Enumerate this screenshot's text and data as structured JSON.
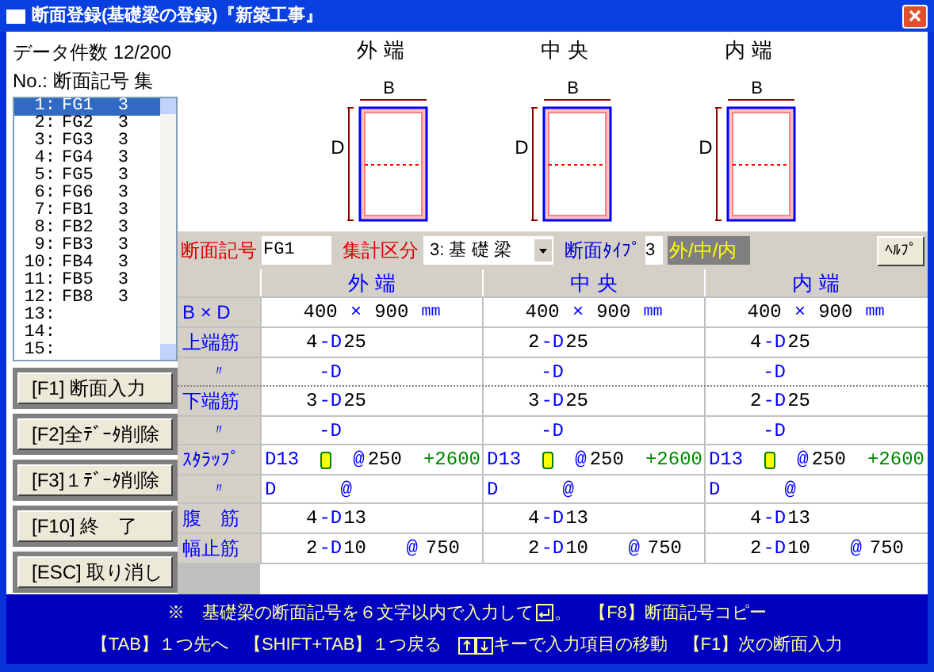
{
  "window": {
    "title": "断面登録(基礎梁の登録)『新築工事』"
  },
  "data_count": "データ件数 12/200",
  "list_header": "No.: 断面記号 集",
  "list": [
    {
      "no": "1:",
      "symbol": "FG1",
      "count": "3",
      "selected": true
    },
    {
      "no": "2:",
      "symbol": "FG2",
      "count": "3",
      "selected": false
    },
    {
      "no": "3:",
      "symbol": "FG3",
      "count": "3",
      "selected": false
    },
    {
      "no": "4:",
      "symbol": "FG4",
      "count": "3",
      "selected": false
    },
    {
      "no": "5:",
      "symbol": "FG5",
      "count": "3",
      "selected": false
    },
    {
      "no": "6:",
      "symbol": "FG6",
      "count": "3",
      "selected": false
    },
    {
      "no": "7:",
      "symbol": "FB1",
      "count": "3",
      "selected": false
    },
    {
      "no": "8:",
      "symbol": "FB2",
      "count": "3",
      "selected": false
    },
    {
      "no": "9:",
      "symbol": "FB3",
      "count": "3",
      "selected": false
    },
    {
      "no": "10:",
      "symbol": "FB4",
      "count": "3",
      "selected": false
    },
    {
      "no": "11:",
      "symbol": "FB5",
      "count": "3",
      "selected": false
    },
    {
      "no": "12:",
      "symbol": "FB8",
      "count": "3",
      "selected": false
    },
    {
      "no": "13:",
      "selected": false
    },
    {
      "no": "14:",
      "selected": false
    },
    {
      "no": "15:",
      "selected": false
    }
  ],
  "buttons": [
    "[F1] 断面入力",
    "[F2]全ﾃﾞｰﾀ削除",
    "[F3]１ﾃﾞｰﾀ削除",
    "[F10] 終　了",
    "[ESC] 取り消し"
  ],
  "diagrams": [
    {
      "title": "外 端",
      "b": "B",
      "d": "D"
    },
    {
      "title": "中 央",
      "b": "B",
      "d": "D"
    },
    {
      "title": "内 端",
      "b": "B",
      "d": "D"
    }
  ],
  "toolbar": {
    "symbol_label": "断面記号",
    "symbol_value": "FG1",
    "category_label": "集計区分",
    "category_value": "3: 基 礎 梁",
    "type_label": "断面ﾀｲﾌﾟ",
    "type_value": "3",
    "type_display": "外/中/内",
    "help": "ﾍﾙﾌﾟ"
  },
  "table": {
    "columns": [
      "外 端",
      "中 央",
      "内 端"
    ],
    "rows": [
      {
        "label": "B × D",
        "kind": "size",
        "cells": [
          [
            {
              "kind": "num",
              "text": "400"
            },
            {
              "kind": "sym",
              "text": "×"
            },
            {
              "kind": "num",
              "text": "900"
            },
            {
              "kind": "unit",
              "text": "mm"
            }
          ],
          [
            {
              "kind": "num",
              "text": "400"
            },
            {
              "kind": "sym",
              "text": "×"
            },
            {
              "kind": "num",
              "text": "900"
            },
            {
              "kind": "unit",
              "text": "mm"
            }
          ],
          [
            {
              "kind": "num",
              "text": "400"
            },
            {
              "kind": "sym",
              "text": "×"
            },
            {
              "kind": "num",
              "text": "900"
            },
            {
              "kind": "unit",
              "text": "mm"
            }
          ]
        ]
      },
      {
        "label": "上端筋",
        "kind": "bar",
        "cells": [
          [
            {
              "kind": "num",
              "text": "4"
            },
            {
              "kind": "sym",
              "text": "-D"
            },
            {
              "kind": "num",
              "text": "25"
            }
          ],
          [
            {
              "kind": "num",
              "text": "2"
            },
            {
              "kind": "sym",
              "text": "-D"
            },
            {
              "kind": "num",
              "text": "25"
            }
          ],
          [
            {
              "kind": "num",
              "text": "4"
            },
            {
              "kind": "sym",
              "text": "-D"
            },
            {
              "kind": "num",
              "text": "25"
            }
          ]
        ]
      },
      {
        "label": "〃",
        "kind": "bar_sub",
        "cells": [
          [
            {
              "kind": "sym",
              "text": "-D"
            }
          ],
          [
            {
              "kind": "sym",
              "text": "-D"
            }
          ],
          [
            {
              "kind": "sym",
              "text": "-D"
            }
          ]
        ]
      },
      {
        "label": "下端筋",
        "kind": "bar",
        "cells": [
          [
            {
              "kind": "num",
              "text": "3"
            },
            {
              "kind": "sym",
              "text": "-D"
            },
            {
              "kind": "num",
              "text": "25"
            }
          ],
          [
            {
              "kind": "num",
              "text": "3"
            },
            {
              "kind": "sym",
              "text": "-D"
            },
            {
              "kind": "num",
              "text": "25"
            }
          ],
          [
            {
              "kind": "num",
              "text": "2"
            },
            {
              "kind": "sym",
              "text": "-D"
            },
            {
              "kind": "num",
              "text": "25"
            }
          ]
        ]
      },
      {
        "label": "〃",
        "kind": "bar_sub",
        "cells": [
          [
            {
              "kind": "sym",
              "text": "-D"
            }
          ],
          [
            {
              "kind": "sym",
              "text": "-D"
            }
          ],
          [
            {
              "kind": "sym",
              "text": "-D"
            }
          ]
        ]
      },
      {
        "label": "ｽﾀﾗｯﾌﾟ",
        "kind": "stirrup",
        "cells": [
          [
            {
              "kind": "sym",
              "text": "D13"
            },
            {
              "kind": "marker"
            },
            {
              "kind": "at",
              "text": "@"
            },
            {
              "kind": "num",
              "text": "250"
            },
            {
              "kind": "extra",
              "text": "+2600"
            }
          ],
          [
            {
              "kind": "sym",
              "text": "D13"
            },
            {
              "kind": "marker"
            },
            {
              "kind": "at",
              "text": "@"
            },
            {
              "kind": "num",
              "text": "250"
            },
            {
              "kind": "extra",
              "text": "+2600"
            }
          ],
          [
            {
              "kind": "sym",
              "text": "D13"
            },
            {
              "kind": "marker"
            },
            {
              "kind": "at",
              "text": "@"
            },
            {
              "kind": "num",
              "text": "250"
            },
            {
              "kind": "extra",
              "text": "+2600"
            }
          ]
        ]
      },
      {
        "label": "〃",
        "kind": "stirrup_sub",
        "cells": [
          [
            {
              "kind": "sym",
              "text": "D"
            },
            {
              "kind": "at",
              "text": "@"
            }
          ],
          [
            {
              "kind": "sym",
              "text": "D"
            },
            {
              "kind": "at",
              "text": "@"
            }
          ],
          [
            {
              "kind": "sym",
              "text": "D"
            },
            {
              "kind": "at",
              "text": "@"
            }
          ]
        ]
      },
      {
        "label": "腹　筋",
        "kind": "bar",
        "cells": [
          [
            {
              "kind": "num",
              "text": "4"
            },
            {
              "kind": "sym",
              "text": "-D"
            },
            {
              "kind": "num",
              "text": "13"
            }
          ],
          [
            {
              "kind": "num",
              "text": "4"
            },
            {
              "kind": "sym",
              "text": "-D"
            },
            {
              "kind": "num",
              "text": "13"
            }
          ],
          [
            {
              "kind": "num",
              "text": "4"
            },
            {
              "kind": "sym",
              "text": "-D"
            },
            {
              "kind": "num",
              "text": "13"
            }
          ]
        ]
      },
      {
        "label": "幅止筋",
        "kind": "tie",
        "cells": [
          [
            {
              "kind": "num",
              "text": "2"
            },
            {
              "kind": "sym",
              "text": "-D"
            },
            {
              "kind": "num",
              "text": "10"
            },
            {
              "kind": "at",
              "text": "@"
            },
            {
              "kind": "num",
              "text": "750"
            }
          ],
          [
            {
              "kind": "num",
              "text": "2"
            },
            {
              "kind": "sym",
              "text": "-D"
            },
            {
              "kind": "num",
              "text": "10"
            },
            {
              "kind": "at",
              "text": "@"
            },
            {
              "kind": "num",
              "text": "750"
            }
          ],
          [
            {
              "kind": "num",
              "text": "2"
            },
            {
              "kind": "sym",
              "text": "-D"
            },
            {
              "kind": "num",
              "text": "10"
            },
            {
              "kind": "at",
              "text": "@"
            },
            {
              "kind": "num",
              "text": "750"
            }
          ]
        ]
      }
    ]
  },
  "hints": {
    "line1": [
      "※　基礎梁の断面記号を６文字以内で入力して",
      "。　【F8】断面記号コピー"
    ],
    "line2": [
      "【TAB】１つ先へ",
      "【SHIFT+TAB】１つ戻る",
      "キーで入力項目の移動",
      "【F1】次の断面入力"
    ]
  }
}
